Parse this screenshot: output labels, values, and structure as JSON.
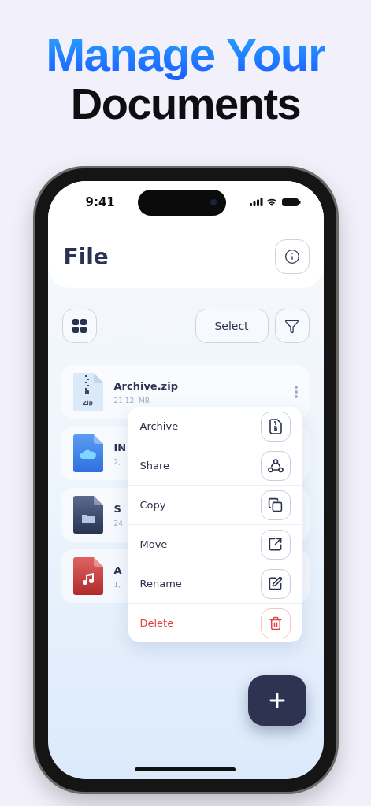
{
  "headline": {
    "line_1": "Manage Your",
    "line_2": "Documents"
  },
  "status_bar": {
    "time": "9:41"
  },
  "header": {
    "title": "File"
  },
  "toolbar": {
    "select_label": "Select"
  },
  "files": [
    {
      "kind": "zip",
      "icon_label": "Zip",
      "name": "Archive.zip",
      "size": "21,12  MB"
    },
    {
      "kind": "cloud",
      "name": "IN",
      "size": "2,"
    },
    {
      "kind": "folder",
      "name": "S",
      "size": "24"
    },
    {
      "kind": "audio",
      "name": "A",
      "size": "1,"
    }
  ],
  "menu": [
    {
      "kind": "normal",
      "label": "Archive"
    },
    {
      "kind": "normal",
      "label": "Share"
    },
    {
      "kind": "normal",
      "label": "Copy"
    },
    {
      "kind": "normal",
      "label": "Move"
    },
    {
      "kind": "normal",
      "label": "Rename"
    },
    {
      "kind": "destructive",
      "label": "Delete"
    }
  ]
}
